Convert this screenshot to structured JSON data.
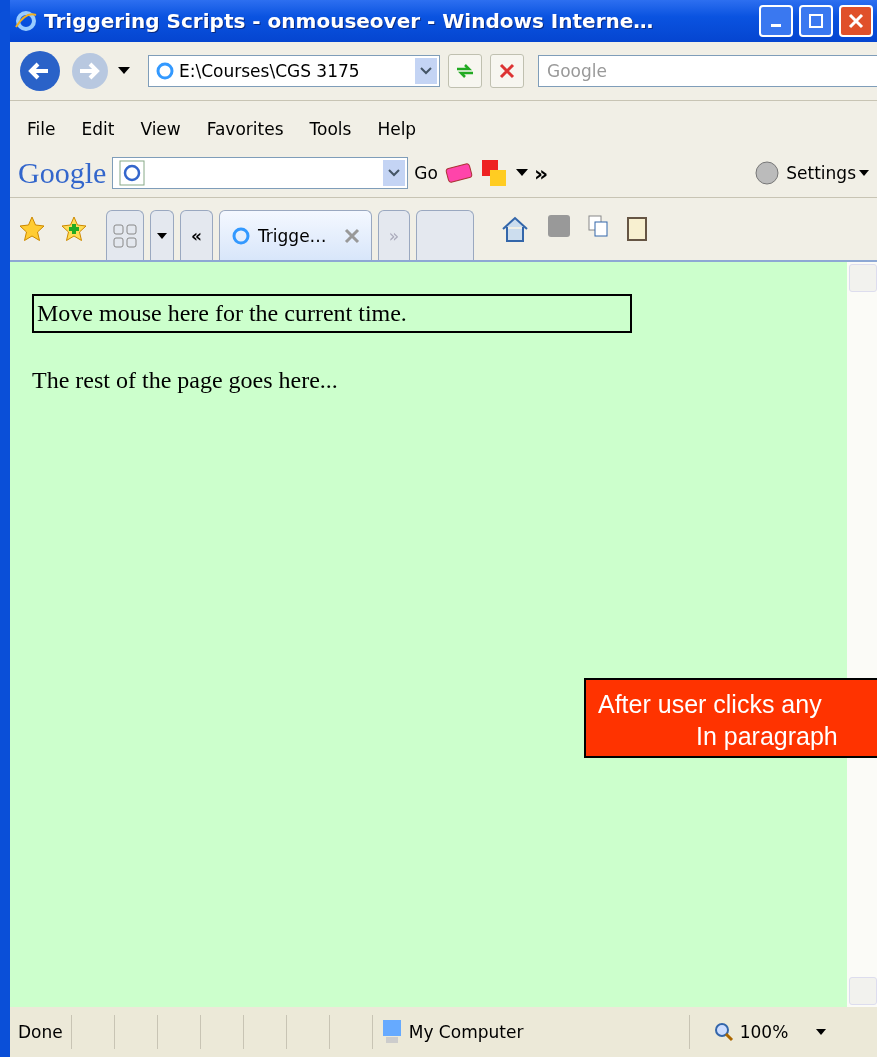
{
  "window": {
    "title": "Triggering Scripts - onmouseover - Windows Interne…"
  },
  "address": {
    "value": "E:\\Courses\\CGS 3175"
  },
  "search": {
    "placeholder": "Google"
  },
  "menu": [
    "File",
    "Edit",
    "View",
    "Favorites",
    "Tools",
    "Help"
  ],
  "google_bar": {
    "logo": "Google",
    "go": "Go",
    "more": "»",
    "settings": "Settings"
  },
  "tabs": [
    {
      "label": "Trigge…",
      "selected": true
    }
  ],
  "tab_more": "»",
  "nav_left": "«",
  "page": {
    "boxed_text": "Move mouse here for the current time.",
    "paragraph": "The rest of the page goes here..."
  },
  "callout": {
    "lines": [
      "After user clicks any",
      "In paragraph"
    ]
  },
  "status_bar": {
    "status": "Done",
    "zone": "My Computer",
    "zoom": "100%"
  }
}
